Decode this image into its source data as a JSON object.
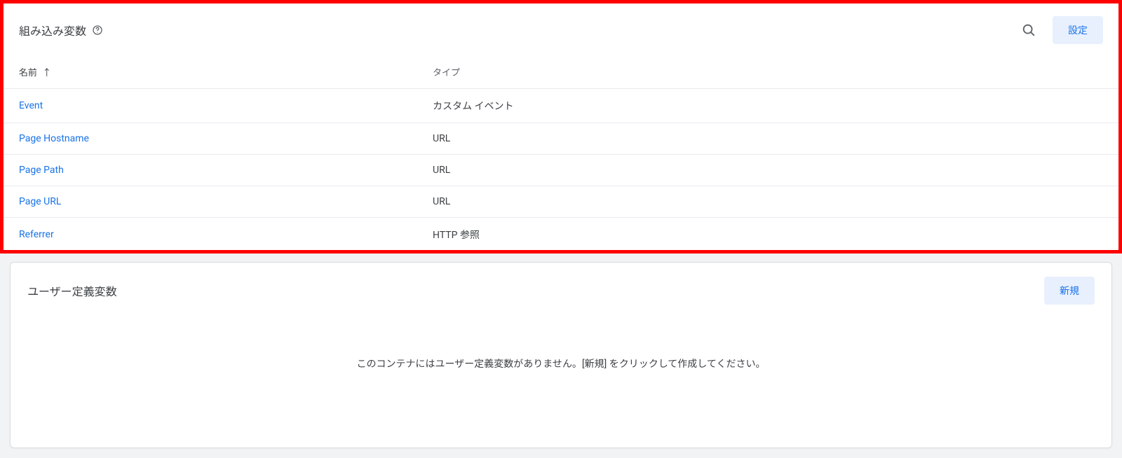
{
  "builtin": {
    "title": "組み込み変数",
    "configure_button": "設定",
    "columns": {
      "name": "名前",
      "type": "タイプ"
    },
    "rows": [
      {
        "name": "Event",
        "type": "カスタム イベント"
      },
      {
        "name": "Page Hostname",
        "type": "URL"
      },
      {
        "name": "Page Path",
        "type": "URL"
      },
      {
        "name": "Page URL",
        "type": "URL"
      },
      {
        "name": "Referrer",
        "type": "HTTP 参照"
      }
    ]
  },
  "user_defined": {
    "title": "ユーザー定義変数",
    "new_button": "新規",
    "empty_message": "このコンテナにはユーザー定義変数がありません。[新規] をクリックして作成してください。"
  },
  "icons": {
    "help": "help-icon",
    "search": "search-icon",
    "sort_asc": "↑"
  }
}
